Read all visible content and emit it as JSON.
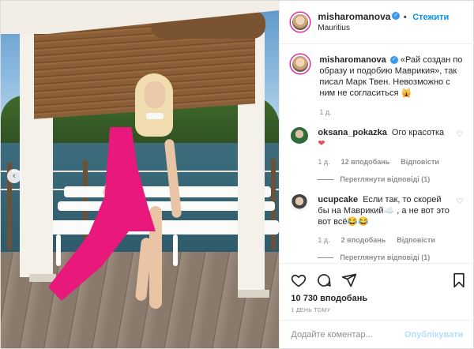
{
  "header": {
    "username": "misharomanova",
    "separator": "•",
    "follow_label": "Стежити",
    "location": "Mauritius"
  },
  "caption": {
    "author": "misharomanova",
    "text": "«Рай создан по образу и подобию Маврикия», так писал Марк Твен. Невозможно с ним не согласиться 🙀",
    "date": "1 д."
  },
  "comments": [
    {
      "author": "oksana_pokazka",
      "text": "Ого красотка",
      "emoji": "❤",
      "date": "1 д.",
      "likes": "12 вподобань",
      "reply": "Відповісти",
      "view_replies": "Переглянути відповіді (1)"
    },
    {
      "author": "ucupcake",
      "text": "Если так, то скорей бы на Маврикий☁️ , а не вот это вот всё😂😂",
      "date": "1 д.",
      "likes": "2 вподобань",
      "reply": "Відповісти",
      "view_replies": "Переглянути відповіді (1)"
    }
  ],
  "actions": {
    "likes": "10 730 вподобань",
    "when": "1 ДЕНЬ ТОМУ"
  },
  "add_comment": {
    "placeholder": "Додайте коментар...",
    "publish_label": "Опублікувати"
  },
  "colors": {
    "accent": "#0095f6",
    "publish_disabled": "#b2dffc",
    "verified": "#3897f0",
    "dress": "#e8197a"
  },
  "icons": {
    "carousel_prev": "chevron-left-icon",
    "like": "heart-icon",
    "comment": "comment-icon",
    "share": "share-icon",
    "save": "bookmark-icon",
    "comment_like": "heart-small-icon"
  }
}
